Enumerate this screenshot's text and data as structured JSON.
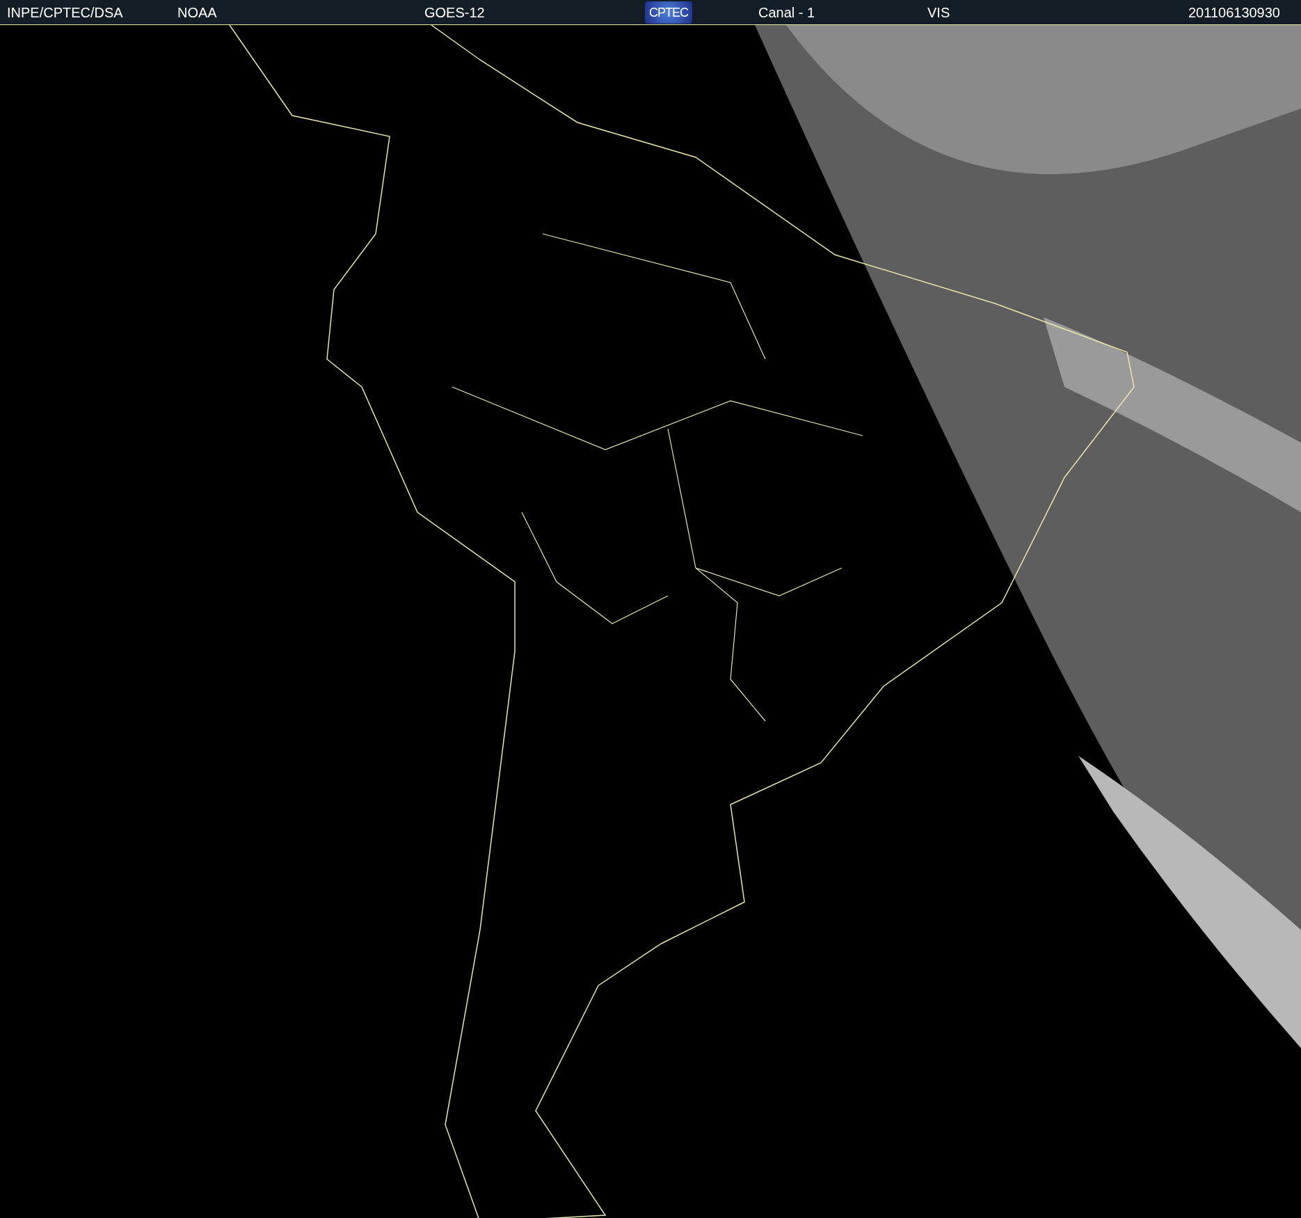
{
  "header": {
    "items": [
      {
        "text": "INPE/CPTEC/DSA",
        "kind": "text"
      },
      {
        "text": "NOAA",
        "kind": "text"
      },
      {
        "text": "GOES-12",
        "kind": "text"
      },
      {
        "text": "CPTEC",
        "kind": "logo"
      },
      {
        "text": "Canal - 1",
        "kind": "text"
      },
      {
        "text": "VIS",
        "kind": "text"
      },
      {
        "text": "201106130930",
        "kind": "text"
      }
    ]
  }
}
